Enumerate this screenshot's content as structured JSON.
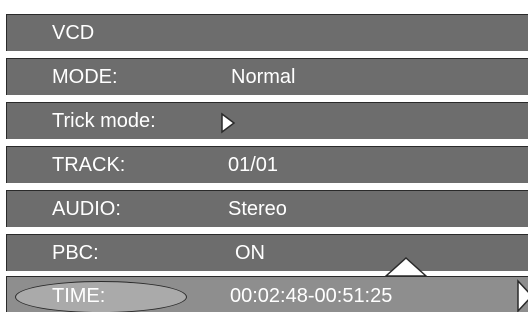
{
  "osd": {
    "header": "VCD",
    "mode": {
      "label": "MODE:",
      "value": "Normal"
    },
    "trick_mode": {
      "label": "Trick mode:",
      "icon": "play-arrow-icon"
    },
    "track": {
      "label": "TRACK:",
      "value": "01/01"
    },
    "audio": {
      "label": "AUDIO:",
      "value": "Stereo"
    },
    "pbc": {
      "label": "PBC:",
      "value": "ON"
    },
    "time": {
      "label": "TIME:",
      "value": "00:02:48-00:51:25"
    }
  },
  "colors": {
    "row_background": "#6d6d6d",
    "selected_row_background": "#8e8e8e",
    "selection_pill": "#aaaaaa",
    "border": "#2a2a2a",
    "text": "#ffffff"
  },
  "icons": {
    "up": "triangle-up-icon",
    "right": "triangle-right-icon"
  }
}
